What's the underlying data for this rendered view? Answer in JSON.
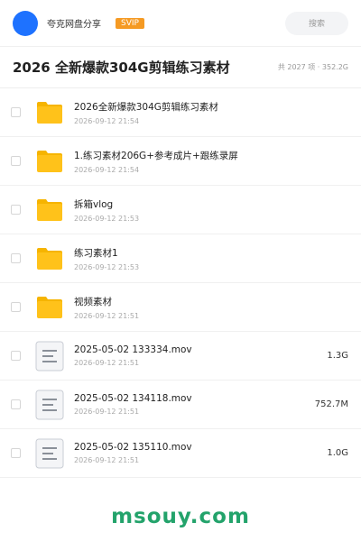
{
  "header": {
    "app_name": "夸克网盘分享",
    "badge": "SVIP",
    "search_placeholder": "搜索"
  },
  "folder": {
    "title": "2026 全新爆款304G剪辑练习素材",
    "meta": "共 2027 项 · 352.2G"
  },
  "colors": {
    "accent": "#1e72ff",
    "badge": "#f59a23",
    "folder": "#ffc21a",
    "watermark": "#23a36b"
  },
  "items": [
    {
      "type": "folder",
      "icon": "folder-icon",
      "name": "2026全新爆款304G剪辑练习素材",
      "date": "2026-09-12 21:54",
      "size": ""
    },
    {
      "type": "folder",
      "icon": "folder-icon",
      "name": "1.练习素材206G+参考成片+跟练录屏",
      "date": "2026-09-12 21:54",
      "size": ""
    },
    {
      "type": "folder",
      "icon": "folder-icon",
      "name": "拆箱vlog",
      "date": "2026-09-12 21:53",
      "size": ""
    },
    {
      "type": "folder",
      "icon": "folder-icon",
      "name": "练习素材1",
      "date": "2026-09-12 21:53",
      "size": ""
    },
    {
      "type": "folder",
      "icon": "folder-icon",
      "name": "视频素材",
      "date": "2026-09-12 21:51",
      "size": ""
    },
    {
      "type": "file",
      "icon": "document-icon",
      "name": "2025-05-02 133334.mov",
      "date": "2026-09-12 21:51",
      "size": "1.3G"
    },
    {
      "type": "file",
      "icon": "document-icon",
      "name": "2025-05-02 134118.mov",
      "date": "2026-09-12 21:51",
      "size": "752.7M"
    },
    {
      "type": "file",
      "icon": "document-icon",
      "name": "2025-05-02 135110.mov",
      "date": "2026-09-12 21:51",
      "size": "1.0G"
    }
  ],
  "watermark": "msouy.com"
}
